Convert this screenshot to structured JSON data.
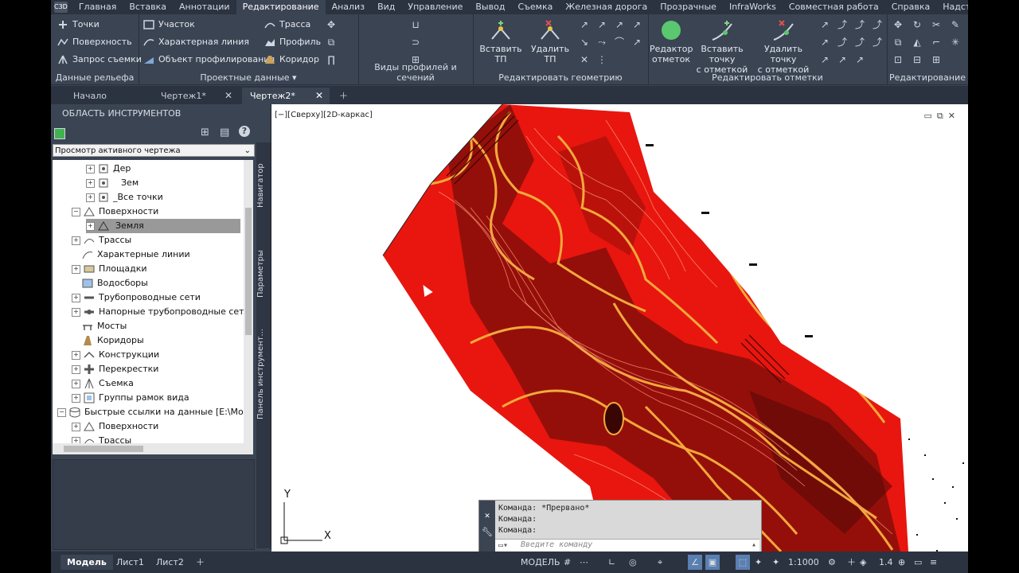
{
  "app": {
    "logo": "C3D"
  },
  "menu_tabs": [
    "Главная",
    "Вставка",
    "Аннотации",
    "Редактирование",
    "Анализ",
    "Вид",
    "Управление",
    "Вывод",
    "Съемка",
    "Железная дорога",
    "Прозрачные",
    "InfraWorks",
    "Совместная работа",
    "Справка",
    "Надстройки"
  ],
  "ribbon": {
    "terrain": {
      "title": "Данные рельефа",
      "points": "Точки",
      "surface": "Поверхность",
      "survey_query": "Запрос съемки"
    },
    "design": {
      "title": "Проектные данные",
      "parcel": "Участок",
      "feature_line": "Характерная линия",
      "grading_object": "Объект профилирования",
      "alignment": "Трасса",
      "profile": "Профиль",
      "corridor": "Коридор"
    },
    "profile_views": {
      "title": "Виды профилей и сечений"
    },
    "edit_geometry": {
      "title": "Редактировать геометрию",
      "insert_pi": "Вставить ТП",
      "delete_pi": "Удалить ТП"
    },
    "edit_elevations": {
      "title": "Редактировать отметки",
      "elevation_editor": [
        "Редактор",
        "отметок"
      ],
      "insert_elev_point": [
        "Вставить точку",
        "с отметкой"
      ],
      "delete_elev_point": [
        "Удалить точку",
        "с отметкой"
      ]
    },
    "modify": {
      "title": "Редактирование"
    }
  },
  "doc_tabs": [
    {
      "label": "Начало"
    },
    {
      "label": "Чертеж1*"
    },
    {
      "label": "Чертеж2*"
    }
  ],
  "toolspace": {
    "title": "ОБЛАСТЬ ИНСТРУМЕНТОВ",
    "view_select": "Просмотр активного чертежа",
    "side_tabs": [
      "Навигатор",
      "Параметры",
      "Панель инструмент..."
    ],
    "tree": [
      {
        "label": "Дер"
      },
      {
        "label": "Зем"
      },
      {
        "label": "_Все точки"
      },
      {
        "label": "Поверхности"
      },
      {
        "label": "Земля"
      },
      {
        "label": "Трассы"
      },
      {
        "label": "Характерные линии"
      },
      {
        "label": "Площадки"
      },
      {
        "label": "Водосборы"
      },
      {
        "label": "Трубопроводные сети"
      },
      {
        "label": "Напорные трубопроводные сети"
      },
      {
        "label": "Мосты"
      },
      {
        "label": "Коридоры"
      },
      {
        "label": "Конструкции"
      },
      {
        "label": "Перекрестки"
      },
      {
        "label": "Съемка"
      },
      {
        "label": "Группы рамок вида"
      },
      {
        "label": "Быстрые ссылки на данные [E:\\Мои д..."
      },
      {
        "label": "Поверхности"
      },
      {
        "label": "Трассы"
      }
    ]
  },
  "viewport": {
    "label": "[−][Сверху][2D-каркас]",
    "axis_y": "Y",
    "axis_x": "X"
  },
  "command": {
    "lines": [
      "Команда:  *Прервано*",
      "Команда:",
      "Команда:"
    ],
    "placeholder": "Введите команду"
  },
  "status": {
    "layouts": [
      "Модель",
      "Лист1",
      "Лист2"
    ],
    "model": "МОДЕЛЬ",
    "scale": "1:1000",
    "value": "1.4"
  }
}
